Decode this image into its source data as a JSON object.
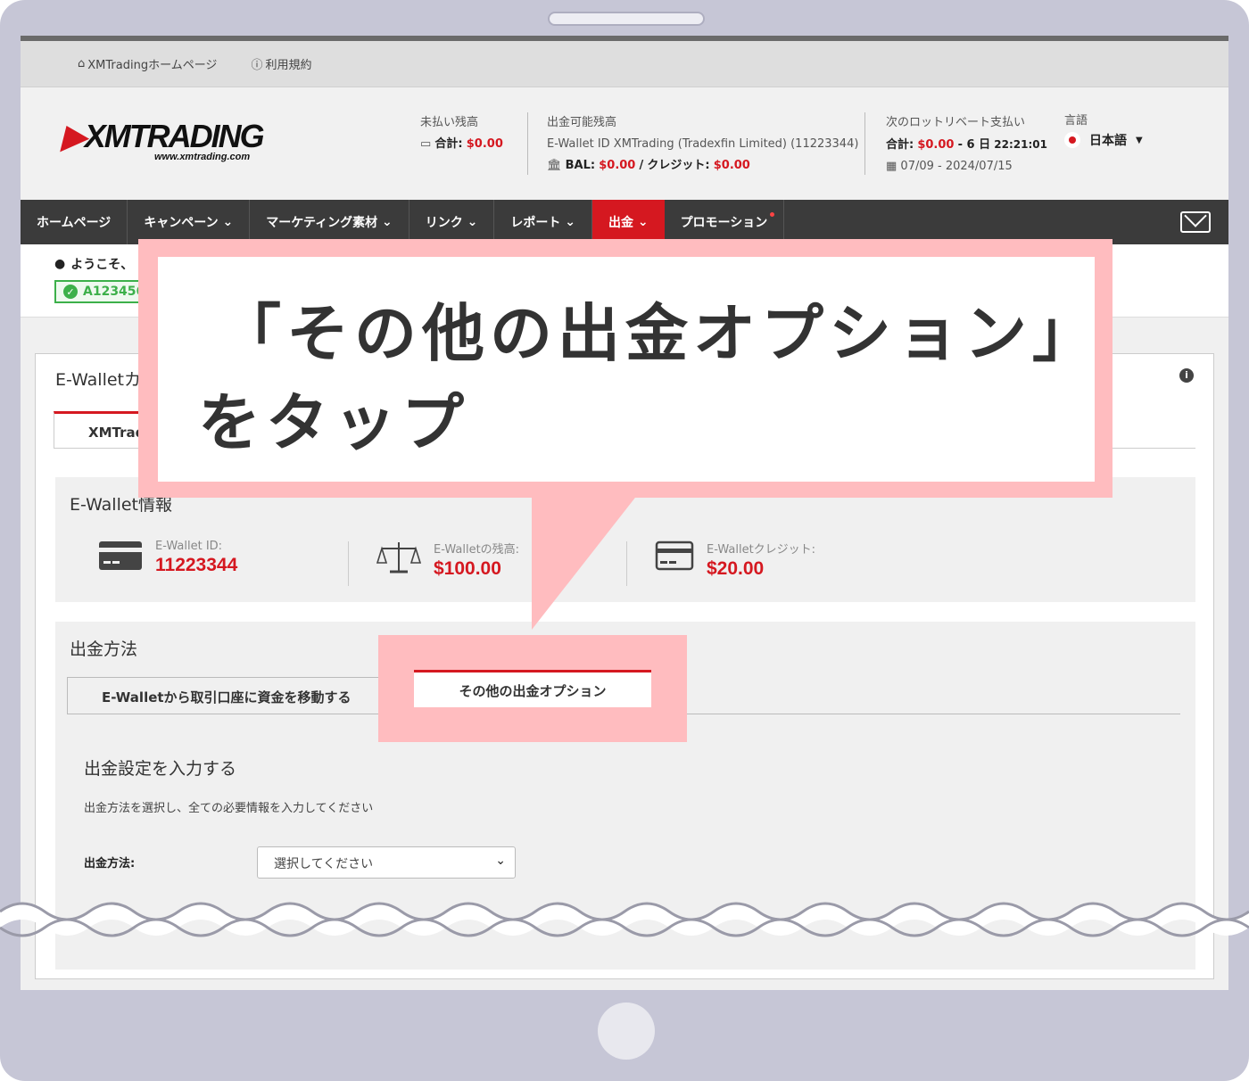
{
  "utility": {
    "home": "XMTradingホームページ",
    "terms": "利用規約"
  },
  "logo": {
    "brand": "XMTRADING",
    "url": "www.xmtrading.com"
  },
  "header": {
    "unpaid": {
      "label": "未払い残高",
      "total_label": "合計:",
      "total_value": "$0.00"
    },
    "withdrawable": {
      "label": "出金可能残高",
      "wallet_line": "E-Wallet ID XMTrading (Tradexfin Limited) (11223344)",
      "bal_label": "BAL:",
      "bal_value": "$0.00",
      "sep": "/",
      "credit_label": "クレジット:",
      "credit_value": "$0.00"
    },
    "rebate": {
      "label": "次のロットリベート支払い",
      "total_label": "合計:",
      "total_value": "$0.00",
      "days": "- 6 日",
      "time": "22:21:01",
      "period": "07/09 - 2024/07/15"
    },
    "language": {
      "label": "言語",
      "value": "日本語"
    }
  },
  "nav": {
    "items": [
      "ホームページ",
      "キャンペーン",
      "マーケティング素材",
      "リンク",
      "レポート",
      "出金",
      "プロモーション"
    ],
    "active_index": 5
  },
  "welcome": {
    "greeting": "ようこそ、",
    "account": "A123456"
  },
  "panel": {
    "title": "E-Walletカ",
    "tab": "XMTrad"
  },
  "ewallet": {
    "title": "E-Wallet情報",
    "id_label": "E-Wallet ID:",
    "id_value": "11223344",
    "balance_label": "E-Walletの残高:",
    "balance_value": "$100.00",
    "credit_label": "E-Walletクレジット:",
    "credit_value": "$20.00"
  },
  "withdraw": {
    "title": "出金方法",
    "tab_transfer": "E-Walletから取引口座に資金を移動する",
    "tab_other": "その他の出金オプション",
    "settings_title": "出金設定を入力する",
    "description": "出金方法を選択し、全ての必要情報を入力してください",
    "method_label": "出金方法:",
    "method_placeholder": "選択してください"
  },
  "callout": {
    "line1": "「その他の出金オプション」",
    "line2": "をタップ"
  }
}
